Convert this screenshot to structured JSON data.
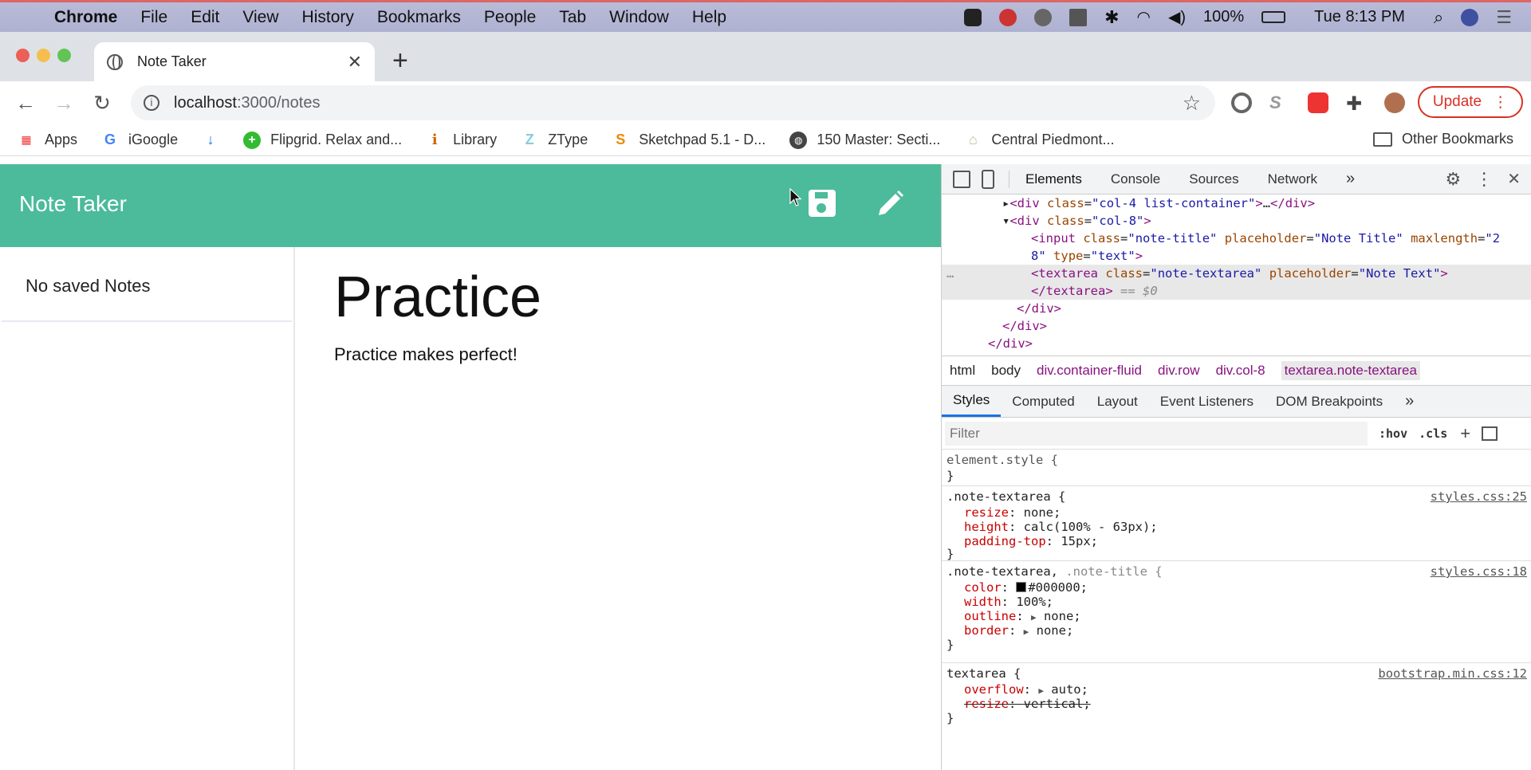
{
  "menubar": {
    "app": "Chrome",
    "items": [
      "File",
      "Edit",
      "View",
      "History",
      "Bookmarks",
      "People",
      "Tab",
      "Window",
      "Help"
    ],
    "battery": "100%",
    "clock": "Tue 8:13 PM"
  },
  "tab": {
    "title": "Note Taker",
    "close": "✕"
  },
  "omnibox": {
    "host": "localhost",
    "path": ":3000/notes"
  },
  "update_button": "Update",
  "bookmarks": {
    "items": [
      "Apps",
      "iGoogle",
      "Flipgrid. Relax and...",
      "Library",
      "ZType",
      "Sketchpad 5.1 - D...",
      "150 Master: Secti...",
      "Central Piedmont..."
    ],
    "other": "Other Bookmarks"
  },
  "app": {
    "brand": "Note Taker",
    "sidebar_empty": "No saved Notes",
    "note_title": "Practice",
    "note_text": "Practice makes perfect!"
  },
  "devtools": {
    "tabs": [
      "Elements",
      "Console",
      "Sources",
      "Network"
    ],
    "dom": {
      "l1_class": "col-4 list-container",
      "l2_class": "col-8",
      "l3_class": "note-title",
      "l3_placeholder": "Note Title",
      "l3_maxlength_a": "2",
      "l3_maxlength_b": "8",
      "l3_type": "text",
      "l4_class": "note-textarea",
      "l4_placeholder": "Note Text",
      "l5_suffix": "== $0"
    },
    "breadcrumbs": [
      "html",
      "body",
      "div.container-fluid",
      "div.row",
      "div.col-8",
      "textarea.note-textarea"
    ],
    "subtabs": [
      "Styles",
      "Computed",
      "Layout",
      "Event Listeners",
      "DOM Breakpoints"
    ],
    "filter_placeholder": "Filter",
    "filter_buttons": [
      ":hov",
      ".cls"
    ],
    "rules": {
      "element_style": "element.style {",
      "r1_selector": ".note-textarea {",
      "r1_source": "styles.css:25",
      "r1_props": [
        "resize",
        "height",
        "padding-top"
      ],
      "r1_values": [
        "none;",
        "calc(100% - 63px);",
        "15px;"
      ],
      "r2_selector_a": ".note-textarea, ",
      "r2_selector_b": ".note-title {",
      "r2_source": "styles.css:18",
      "r2_props": [
        "color",
        "width",
        "outline",
        "border"
      ],
      "r2_values": [
        "#000000;",
        "100%;",
        "none;",
        "none;"
      ],
      "r3_selector": "textarea {",
      "r3_source": "bootstrap.min.css:12",
      "r3_props": [
        "overflow",
        "resize"
      ],
      "r3_values": [
        "auto;",
        "vertical;"
      ]
    }
  }
}
